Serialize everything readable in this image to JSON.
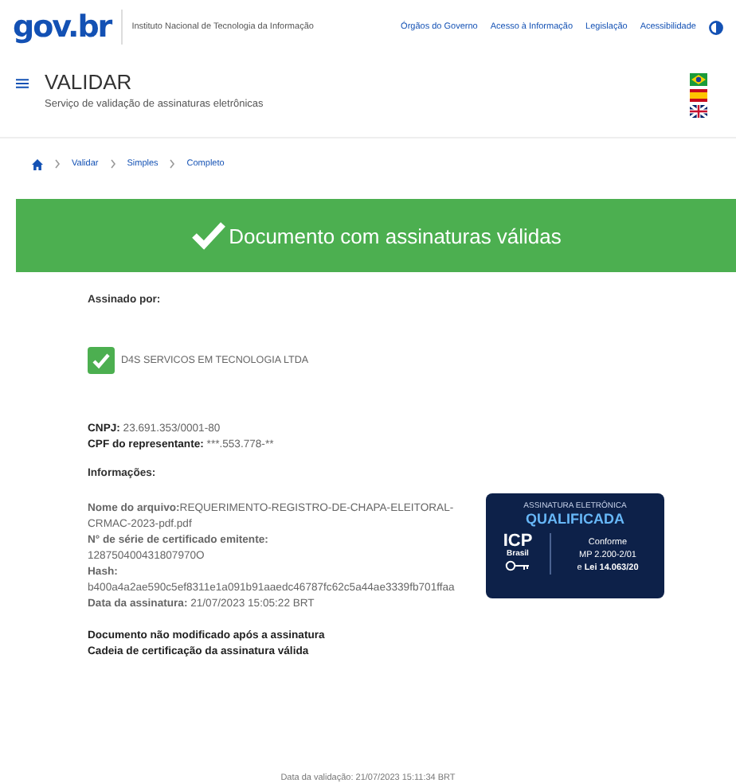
{
  "header": {
    "logo": "gov.br",
    "institute": "Instituto Nacional de Tecnologia da Informação",
    "links": [
      "Órgãos do Governo",
      "Acesso à Informação",
      "Legislação",
      "Acessibilidade"
    ]
  },
  "title": {
    "heading": "VALIDAR",
    "subtitle": "Serviço de validação de assinaturas eletrônicas"
  },
  "breadcrumb": [
    "Validar",
    "Simples",
    "Completo"
  ],
  "banner": {
    "text": "Documento com assinaturas válidas"
  },
  "signed_by": {
    "label": "Assinado por:",
    "signer": "D4S SERVICOS EM TECNOLOGIA LTDA",
    "valid": true
  },
  "identity": [
    {
      "label": "CNPJ:",
      "value": "23.691.353/0001-80"
    },
    {
      "label": "CPF do representante:",
      "value": "***.553.778-**"
    }
  ],
  "info_label": "Informações:",
  "info": [
    "**Nome do arquivo:**REQUERIMENTO-REGISTRO-DE-CHAPA-ELEITORAL-CRMAC-2023-pdf.pdf",
    "**N° de série de certificado emitente:**",
    "128750400431807970O",
    "**Hash:**",
    "b400a4a2ae590c5ef8311e1a091b91aaedc46787fc62c5a44ae3339fb701ffaa",
    "**Data da assinatura:** 21/07/2023 15:05:22 BRT"
  ],
  "status": [
    "Documento não modificado após a assinatura",
    "Cadeia de certificação da assinatura válida"
  ],
  "seal": {
    "top": "ASSINATURA ELETRÔNICA",
    "title": "QUALIFICADA",
    "icp": "ICP",
    "icp_sub": "Brasil",
    "right": [
      "Conforme",
      "MP 2.200-2/01",
      "e **Lei 14.063/20**"
    ]
  },
  "footer": "Data da validação: 21/07/2023 15:11:34 BRT"
}
